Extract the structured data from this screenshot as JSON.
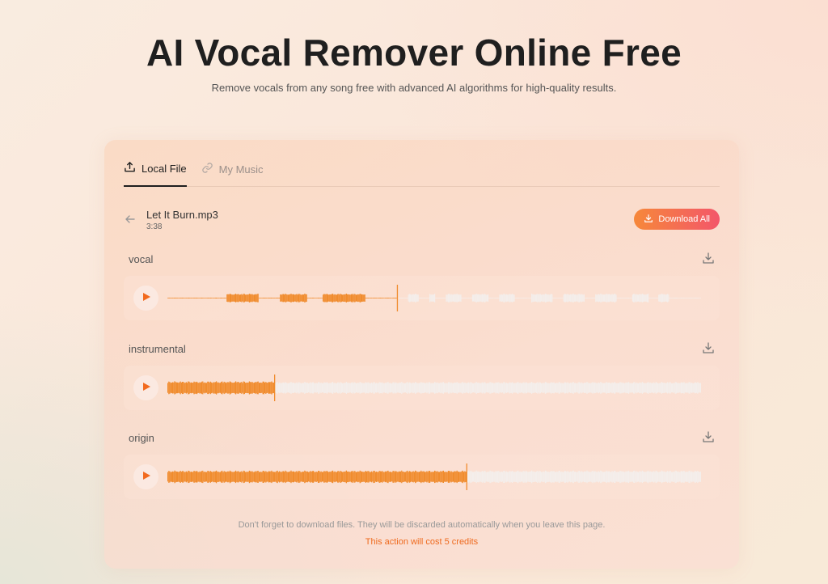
{
  "hero": {
    "title": "AI Vocal Remover Online Free",
    "subtitle": "Remove vocals from any song free with advanced AI algorithms for high-quality results."
  },
  "tabs": [
    {
      "label": "Local File",
      "icon": "upload-icon",
      "active": true
    },
    {
      "label": "My Music",
      "icon": "link-icon",
      "active": false
    }
  ],
  "file": {
    "name": "Let It Burn.mp3",
    "duration": "3:38"
  },
  "download_all_label": "Download All",
  "tracks": [
    {
      "label": "vocal",
      "progress": 0.43
    },
    {
      "label": "instrumental",
      "progress": 0.2
    },
    {
      "label": "origin",
      "progress": 0.56
    }
  ],
  "footer": {
    "note": "Don't forget to download files. They will be discarded automatically when you leave this page.",
    "cost": "This action will cost 5 credits"
  },
  "colors": {
    "accent": "#f58a30",
    "played_wave": "#f08c2e",
    "unplayed_wave": "#f4eeeb",
    "button_gradient_start": "#f6883a",
    "button_gradient_end": "#f3566a",
    "cost_text": "#ef6a1e"
  }
}
